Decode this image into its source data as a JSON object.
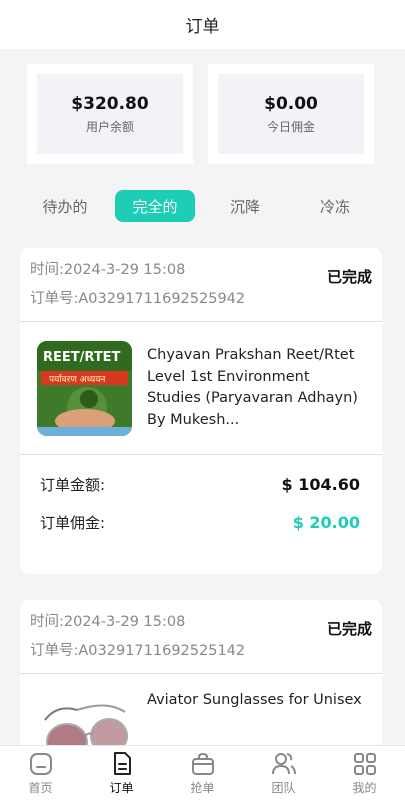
{
  "header": {
    "title": "订单"
  },
  "stats": [
    {
      "value": "$320.80",
      "label": "用户余额"
    },
    {
      "value": "$0.00",
      "label": "今日佣金"
    }
  ],
  "tabs": [
    {
      "label": "待办的"
    },
    {
      "label": "完全的"
    },
    {
      "label": "沉降"
    },
    {
      "label": "冷冻"
    }
  ],
  "orders": [
    {
      "time": "时间:2024-3-29 15:08",
      "order_no": "订单号:A03291711692525942",
      "status": "已完成",
      "product": "Chyavan Prakshan Reet/Rtet Level 1st Environment Studies (Paryavaran Adhayn) By Mukesh...",
      "thumb_text": "REET/RTET",
      "thumb_subtext": "पर्यावरण अध्ययन",
      "amount_label": "订单金额:",
      "amount": "$ 104.60",
      "commission_label": "订单佣金:",
      "commission": "$ 20.00"
    },
    {
      "time": "时间:2024-3-29 15:08",
      "order_no": "订单号:A03291711692525142",
      "status": "已完成",
      "product": "Aviator Sunglasses for Unisex"
    }
  ],
  "tabbar": [
    {
      "label": "首页",
      "icon": "home-icon"
    },
    {
      "label": "订单",
      "icon": "orders-icon"
    },
    {
      "label": "抢单",
      "icon": "bag-icon"
    },
    {
      "label": "团队",
      "icon": "team-icon"
    },
    {
      "label": "我的",
      "icon": "grid-icon"
    }
  ],
  "colors": {
    "accent": "#1ecdb5",
    "background": "#f4f4f6"
  }
}
